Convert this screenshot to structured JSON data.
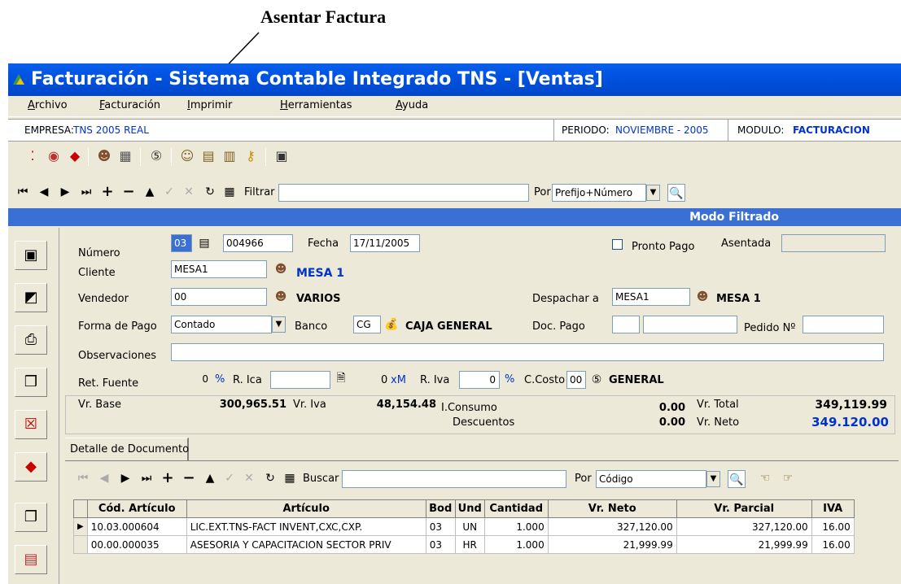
{
  "annotation": {
    "label": "Asentar Factura"
  },
  "window": {
    "title": "Facturación - Sistema Contable Integrado TNS - [Ventas]"
  },
  "menu": [
    "Archivo",
    "Facturación",
    "Imprimir",
    "Herramientas",
    "Ayuda"
  ],
  "info": {
    "empresa_label": "EMPRESA:",
    "empresa_value": "TNS 2005 REAL",
    "periodo_label": "PERIODO:",
    "periodo_value": "NOVIEMBRE - 2005",
    "modulo_label": "MODULO:",
    "modulo_value": "FACTURACION"
  },
  "filter": {
    "label": "Filtrar",
    "value": "",
    "por_label": "Por",
    "por_value": "Prefijo+Número"
  },
  "mode": "Modo Filtrado",
  "form": {
    "numero_label": "Número",
    "prefijo": "03",
    "numero": "004966",
    "fecha_label": "Fecha",
    "fecha": "17/11/2005",
    "pronto_pago_label": "Pronto Pago",
    "asentada_label": "Asentada",
    "asentada": "",
    "cliente_label": "Cliente",
    "cliente_code": "MESA1",
    "cliente_name": "MESA 1",
    "vendedor_label": "Vendedor",
    "vendedor_code": "00",
    "vendedor_name": "VARIOS",
    "despachar_label": "Despachar a",
    "despachar_code": "MESA1",
    "despachar_name": "MESA 1",
    "forma_pago_label": "Forma de Pago",
    "forma_pago": "Contado",
    "banco_label": "Banco",
    "banco_code": "CG",
    "banco_name": "CAJA GENERAL",
    "doc_pago_label": "Doc. Pago",
    "pedido_label": "Pedido Nº",
    "observaciones_label": "Observaciones",
    "observaciones": "",
    "ret_fuente_label": "Ret. Fuente",
    "ret_fuente": "0",
    "pct": "%",
    "rica_label": "R. Ica",
    "rica_value": "0",
    "xm": "xM",
    "riva_label": "R. Iva",
    "riva_value": "0",
    "ccosto_label": "C.Costo",
    "ccosto_code": "00",
    "ccosto_name": "GENERAL"
  },
  "totals": {
    "vr_base_label": "Vr. Base",
    "vr_base": "300,965.51",
    "vr_iva_label": "Vr. Iva",
    "vr_iva": "48,154.48",
    "iconsumo_label": "I.Consumo",
    "iconsumo": "0.00",
    "descuentos_label": "Descuentos",
    "descuentos": "0.00",
    "vr_total_label": "Vr. Total",
    "vr_total": "349,119.99",
    "vr_neto_label": "Vr. Neto",
    "vr_neto": "349.120.00"
  },
  "detail": {
    "tab": "Detalle de Documento",
    "buscar_label": "Buscar",
    "buscar_value": "",
    "por_label": "Por",
    "por_value": "Código",
    "columns": [
      "Cód. Artículo",
      "Artículo",
      "Bod",
      "Und",
      "Cantidad",
      "Vr. Neto",
      "Vr. Parcial",
      "IVA"
    ],
    "rows": [
      [
        "10.03.000604",
        "LIC.EXT.TNS-FACT INVENT,CXC,CXP.",
        "03",
        "UN",
        "1.000",
        "327,120.00",
        "327,120.00",
        "16.00"
      ],
      [
        "00.00.000035",
        "ASESORIA Y CAPACITACION SECTOR PRIV",
        "03",
        "HR",
        "1.000",
        "21,999.99",
        "21,999.99",
        "16.00"
      ]
    ]
  }
}
